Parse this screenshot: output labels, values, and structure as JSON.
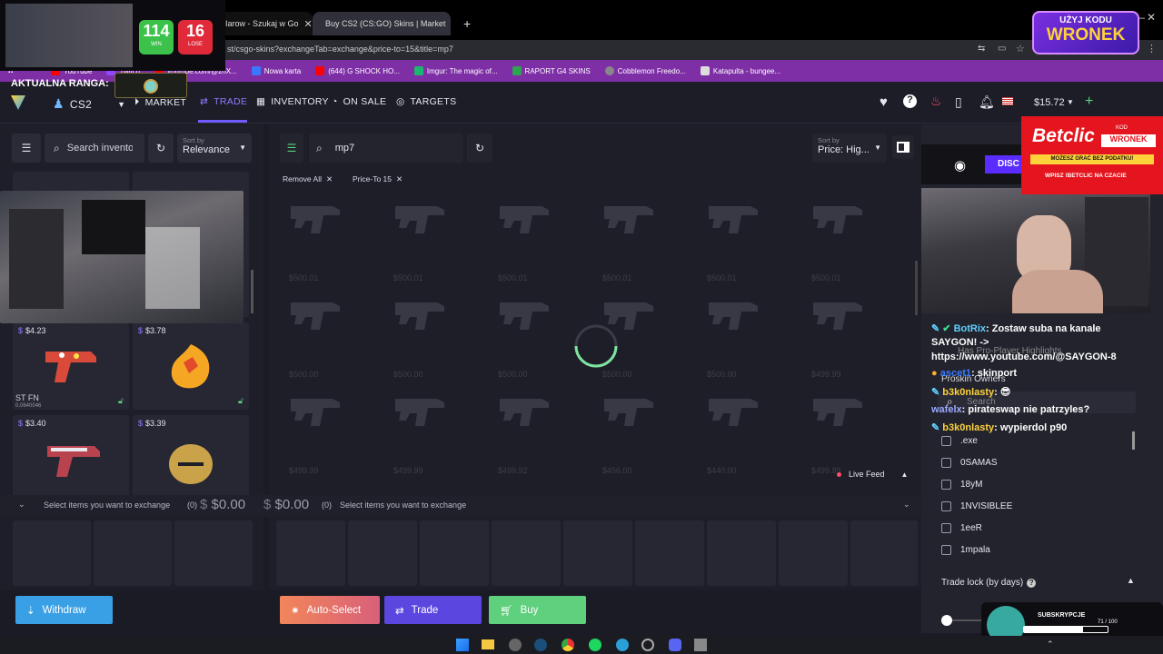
{
  "browser": {
    "tabs": [
      {
        "label": "Iarow - Szukaj w Go",
        "active": false
      },
      {
        "label": "Buy CS2 (CS:GO) Skins | Market",
        "active": true
      }
    ],
    "new_tab": "+",
    "url": "st/csgo-skins?exchangeTab=exchange&price-to=15&title=mp7",
    "bookmarks": [
      "YouTube",
      "Twitch",
      "youtube.com/@zhX...",
      "Nowa karta",
      "(644) G SHOCK HO...",
      "Imgur: The magic of...",
      "RAPORT G4 SKINS",
      "Cobblemon Freedo...",
      "Katapulta - bungee..."
    ]
  },
  "overlay": {
    "wins": "114",
    "wins_label": "WIN",
    "loses": "16",
    "loses_label": "LOSE",
    "rank_label": "AKTUALNA RANGA:",
    "promo_top": "UŻYJ KODU",
    "promo_code": "WRONEK",
    "betclic_brand": "Betclic",
    "betclic_code": "WRONEK",
    "betclic_kod": "KOD",
    "betclic_sub": "MOŻESZ GRAĆ BEZ PODATKU!",
    "betclic_footer": "WPISZ !BETCLIC NA CZACIE",
    "subs_title": "SUBSKRYPCJE",
    "subs_count": "71 / 100"
  },
  "nav": {
    "game": "CS2",
    "market": "MARKET",
    "trade": "TRADE",
    "inventory": "INVENTORY",
    "on_sale": "ON SALE",
    "targets": "TARGETS",
    "balance": "$15.72"
  },
  "left": {
    "search_placeholder": "Search inventory",
    "sort_label": "Sort by",
    "sort_value": "Relevance",
    "items": [
      {
        "price": "$4.23",
        "tag": "ST FN",
        "float": "0.0640046"
      },
      {
        "price": "$3.78",
        "tag": "",
        "float": ""
      },
      {
        "price": "$3.40",
        "tag": "",
        "float": ""
      },
      {
        "price": "$3.39",
        "tag": "",
        "float": ""
      }
    ]
  },
  "center": {
    "search_value": "mp7",
    "sort_label": "Sort by",
    "sort_value": "Price: Hig...",
    "chips": [
      "Remove All",
      "Price-To 15"
    ],
    "ghost_prices": [
      "$500.01",
      "$500.01",
      "$500.01",
      "$500.01",
      "$500.01",
      "$500.01",
      "$500.00",
      "$500.00",
      "$500.00",
      "$500.00",
      "$500.00",
      "$499.99",
      "$499.99",
      "$499.99",
      "$499.92",
      "$456.00",
      "$440.00",
      "$499.99"
    ],
    "live_feed": "Live Feed"
  },
  "tradebar": {
    "left_hint": "Select items you want to exchange",
    "left_count": "(0)",
    "left_total": "$0.00",
    "right_total": "$0.00",
    "right_count": "(0)",
    "right_hint": "Select items you want to exchange"
  },
  "buttons": {
    "withdraw": "Withdraw",
    "auto_select": "Auto-Select",
    "trade": "Trade",
    "buy": "Buy"
  },
  "right": {
    "discord_label": "DISC",
    "pro_player": "Has Pro-Player Highlights",
    "proskin_owners": "Proskin Owners",
    "search_placeholder": "Search",
    "owners": [
      ".exe",
      "0SAMAS",
      "18yM",
      "1NVISIBLEE",
      "1eeR",
      "1mpala"
    ],
    "trade_lock": "Trade lock (by days)"
  },
  "chat": [
    {
      "user": "BotRix",
      "text": ": Zostaw suba na kanale",
      "color": "#5fd0ff"
    },
    {
      "user": "",
      "text": "SAYGON! ->",
      "color": "#ffffff"
    },
    {
      "user": "",
      "text": "https://www.youtube.com/@SAYGON-8",
      "color": "#ffffff"
    },
    {
      "user": "ascet1",
      "text": ": skinport",
      "color": "#3a7bff"
    },
    {
      "user": "b3k0nlasty",
      "text": ":",
      "color": "#ffd23a"
    },
    {
      "user": "wafelx",
      "text": ": pirateswap nie patrzyles?",
      "color": "#9aa8ff"
    },
    {
      "user": "b3k0nlasty",
      "text": ": wypierdol p90",
      "color": "#ffd23a"
    }
  ],
  "colors": {
    "accent_purple": "#5b47e0",
    "withdraw_blue": "#3aa0e6",
    "buy_green": "#5fd07e",
    "bookmark_bar": "#7e2fa6",
    "autoselect": "#e9805e"
  }
}
